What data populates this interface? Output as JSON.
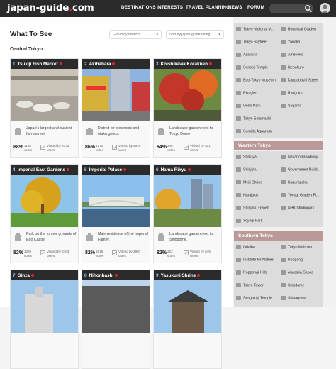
{
  "header": {
    "logo_main": "japan-guide",
    "logo_dot": ".",
    "logo_end": "com",
    "nav": [
      "DESTINATIONS",
      "INTERESTS",
      "TRAVEL PLANNING",
      "NEWS",
      "FORUM"
    ]
  },
  "page": {
    "title": "What To See",
    "filter_group": "Group by districts",
    "filter_sort": "Sort by japan-guide rating",
    "section": "Central Tokyo"
  },
  "cards": [
    {
      "num": "1",
      "name": "Tsukiji Fish Market",
      "desc": "Japan's largest and busiest fish market.",
      "pct": "88%",
      "votes": "1138 votes",
      "visited": "Visited by 2072 users"
    },
    {
      "num": "2",
      "name": "Akihabara",
      "desc": "District for electronic and otaku goods.",
      "pct": "86%",
      "votes": "3270 votes",
      "visited": "Visited by 5929 users"
    },
    {
      "num": "3",
      "name": "Koishikawa Korakuen",
      "desc": "Landscape garden next to Tokyo Dome.",
      "pct": "84%",
      "votes": "248 votes",
      "visited": "Visited by 521 users"
    },
    {
      "num": "4",
      "name": "Imperial East Gardens",
      "desc": "Park on the former grounds of Edo Castle.",
      "pct": "82%",
      "votes": "1236 votes",
      "visited": "Visited by 2403 users"
    },
    {
      "num": "5",
      "name": "Imperial Palace",
      "desc": "Main residence of the Imperial Family.",
      "pct": "82%",
      "votes": "1516 votes",
      "visited": "Visited by 2907 users"
    },
    {
      "num": "6",
      "name": "Hama Rikyu",
      "desc": "Landscape garden next to Shiodome.",
      "pct": "82%",
      "votes": "322 votes",
      "visited": "Visited by 649 users"
    },
    {
      "num": "7",
      "name": "Ginza",
      "desc": "",
      "pct": "",
      "votes": "",
      "visited": ""
    },
    {
      "num": "8",
      "name": "Nihonbashi",
      "desc": "",
      "pct": "",
      "votes": "",
      "visited": ""
    },
    {
      "num": "9",
      "name": "Yasukuni Shrine",
      "desc": "",
      "pct": "",
      "votes": "",
      "visited": ""
    }
  ],
  "sidebar": {
    "central": [
      "Tokyo National M...",
      "Botanical Garden",
      "Tokyo Skytree",
      "Yanaka",
      "Asakusa",
      "Ameyoko",
      "Sensoji Temple",
      "Ikebukuro",
      "Edo-Tokyo Museum",
      "Kappabashi Street",
      "Rikugien",
      "Ryogoku",
      "Ueno Park",
      "Sugamo",
      "Tokyo Solamachi",
      "",
      "Sumida Aquarium",
      ""
    ],
    "western_title": "Western Tokyo",
    "western": [
      "Shibuya",
      "Nakano Broadway",
      "Shinjuku",
      "Government Build...",
      "Meiji Shrine",
      "Kagurazaka",
      "Harajuku",
      "Yoyogi Garden Pl...",
      "Shinjuku Gyoen",
      "NHK Studiopark",
      "Yoyogi Park",
      ""
    ],
    "southern_title": "Southern Tokyo",
    "southern": [
      "Odaiba",
      "Tokyo Midtown",
      "Institute for Nature",
      "Roppongi",
      "Roppongi Hills",
      "Akasaka Sacas",
      "Tokyo Tower",
      "Shiodome",
      "Sengakuji Temple",
      "Shinagawa"
    ]
  }
}
